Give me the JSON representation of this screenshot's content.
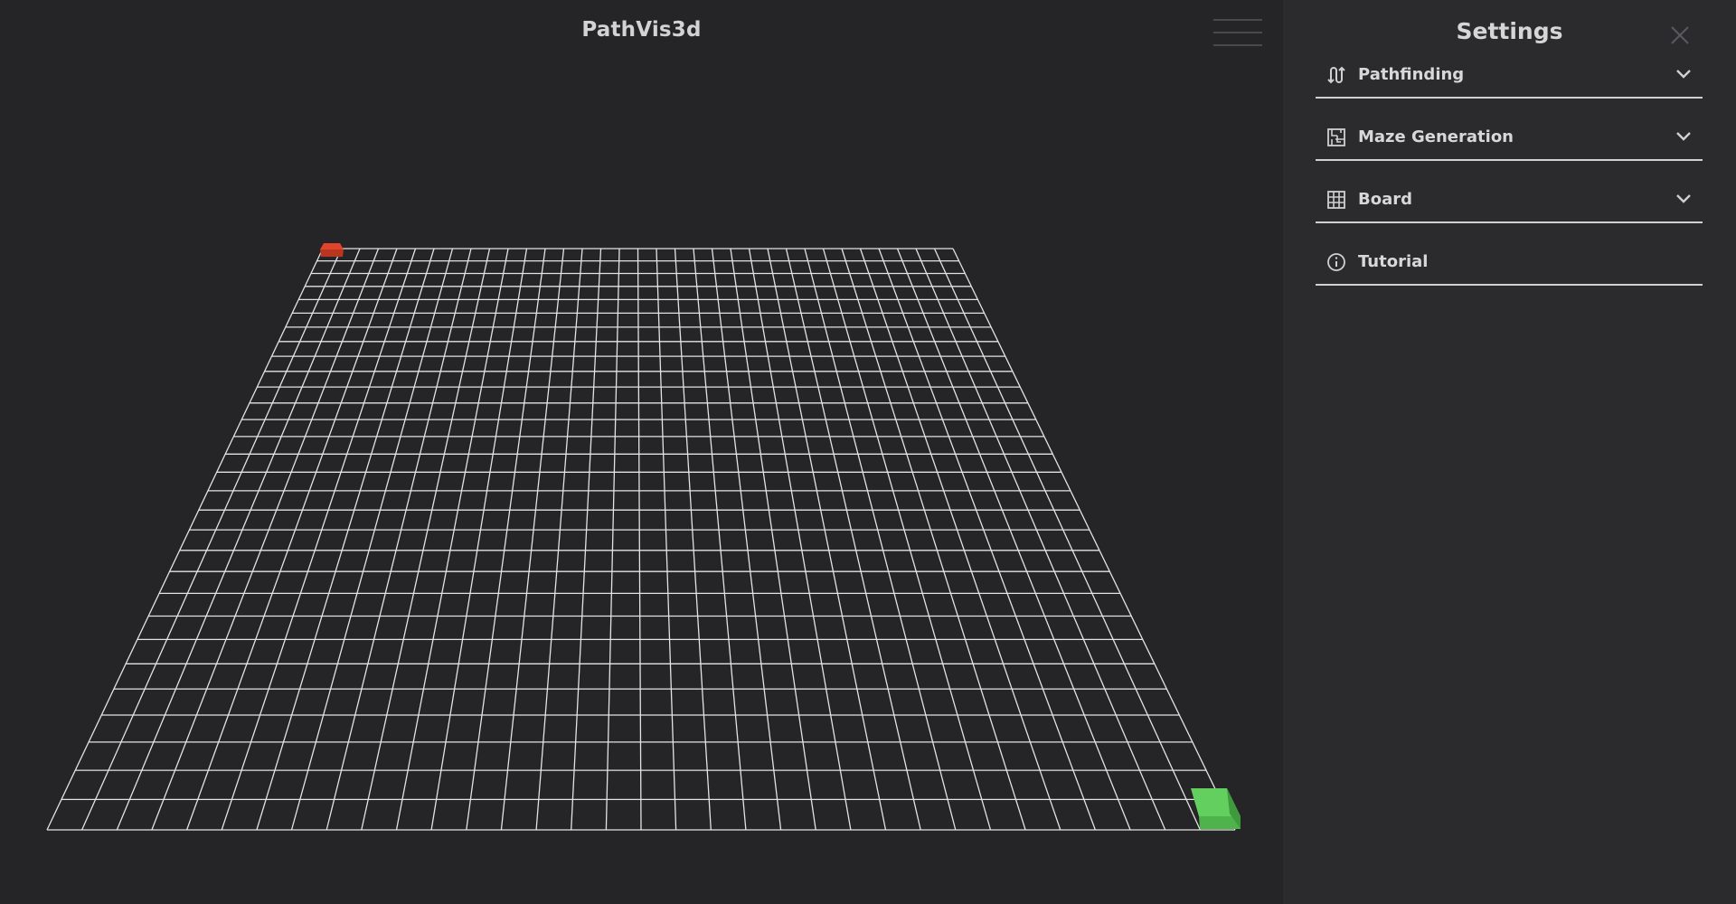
{
  "app": {
    "title": "PathVis3d"
  },
  "settings": {
    "title": "Settings",
    "sections": [
      {
        "label": "Pathfinding",
        "icon": "pathfinding-icon",
        "expandable": true
      },
      {
        "label": "Maze Generation",
        "icon": "maze-icon",
        "expandable": true
      },
      {
        "label": "Board",
        "icon": "grid-icon",
        "expandable": true
      },
      {
        "label": "Tutorial",
        "icon": "info-icon",
        "expandable": false
      }
    ]
  },
  "board": {
    "rows": 30,
    "cols": 34,
    "start_node_color": "#e0442c",
    "end_node_color": "#62cf5e",
    "grid_line_color": "#e3e3e3"
  },
  "colors": {
    "background": "#252527",
    "panel": "#2b2b2e",
    "text": "#d6d6d6"
  }
}
